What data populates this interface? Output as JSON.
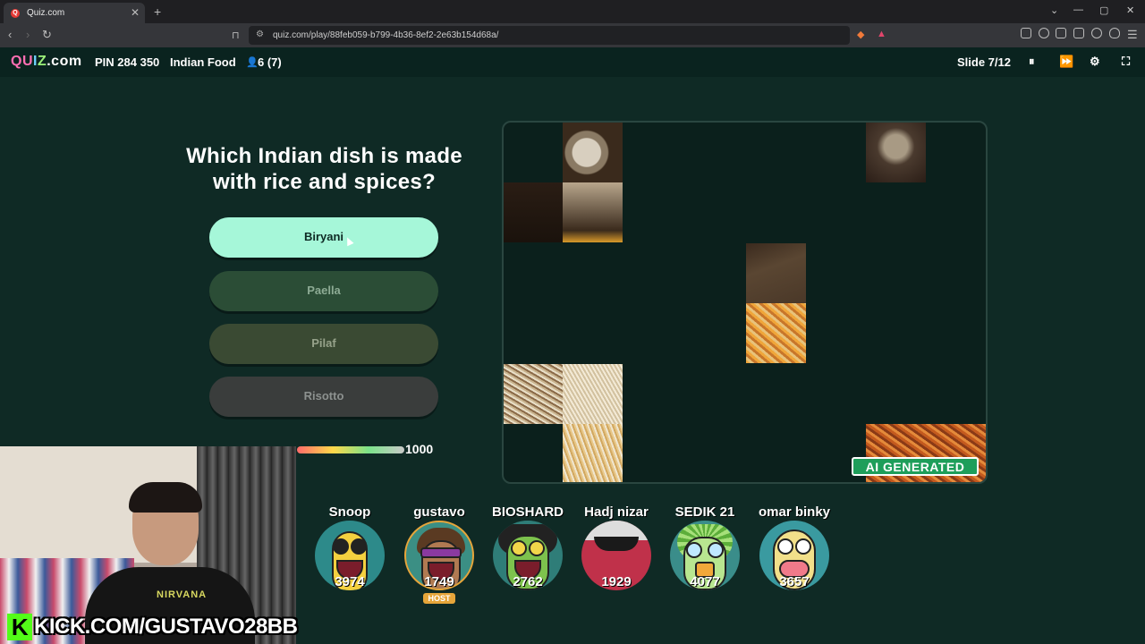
{
  "browser": {
    "tab_title": "Quiz.com",
    "tab_favicon": "Q",
    "url": "quiz.com/play/88feb059-b799-4b36-8ef2-2e63b154d68a/"
  },
  "header": {
    "logo_q": "QU",
    "logo_i": "I",
    "logo_z": "Z",
    "logo_dom": ".com",
    "pin": "PIN 284 350",
    "topic": "Indian Food",
    "players": "6 (7)",
    "slide": "Slide 7/12"
  },
  "quiz": {
    "question": "Which Indian dish is made with rice and spices?",
    "answers": [
      "Biryani",
      "Paella",
      "Pilaf",
      "Risotto"
    ],
    "timer_value": "1000",
    "timer_fraction": 1.0,
    "ai_badge": "AI GENERATED"
  },
  "stream": {
    "kick_text": "KICK.COM/GUSTAVO28BB",
    "kick_logo": "K",
    "shirt_text": "NIRVANA"
  },
  "players": [
    {
      "name": "Snoop",
      "score": "3974",
      "color": "#2d8a8a",
      "face": "#f4d03f"
    },
    {
      "name": "gustavo",
      "score": "1749",
      "color": "#3b8f84",
      "face": "#b07a52",
      "host": "HOST"
    },
    {
      "name": "BIOSHARD",
      "score": "2762",
      "color": "#2f7d78",
      "face": "#7dc24d"
    },
    {
      "name": "Hadj nizar",
      "score": "1929",
      "color": "#c0314a",
      "face": "#d93b55"
    },
    {
      "name": "SEDIK 21",
      "score": "4077",
      "color": "#3a8d8a",
      "face": "#a6e07a"
    },
    {
      "name": "omar binky",
      "score": "3657",
      "color": "#3a9aa0",
      "face": "#f2e08a"
    }
  ],
  "colors": {
    "background": "#0f2a25",
    "correct_answer": "#a6f7d9",
    "ai_badge": "#1e9e5a"
  }
}
